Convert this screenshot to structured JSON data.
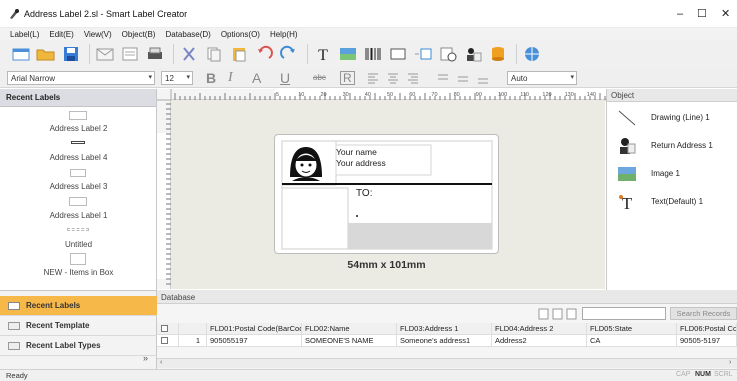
{
  "window": {
    "title": "Address Label 2.sl - Smart Label Creator",
    "minimize": "–",
    "maximize": "☐",
    "close": "✕"
  },
  "menu": [
    "Label(L)",
    "Edit(E)",
    "View(V)",
    "Object(B)",
    "Database(D)",
    "Options(O)",
    "Help(H)"
  ],
  "format": {
    "font": "Arial Narrow",
    "size": "12",
    "bold": "B",
    "italic": "I",
    "color": "A",
    "underline": "U",
    "strike": "abc",
    "autofit": "R",
    "linespacing": "Auto"
  },
  "left": {
    "header": "Recent Labels",
    "labels": [
      "Address Label 2",
      "Address Label 4",
      "Address Label 3",
      "Address Label 1",
      "Untitled",
      "NEW - Items in Box"
    ],
    "tabs": [
      "Recent Labels",
      "Recent Template",
      "Recent Label Types"
    ],
    "expand": "»"
  },
  "ruler": {
    "marks": [
      "5",
      "10",
      "20",
      "30",
      "40",
      "50",
      "60",
      "70",
      "80",
      "90",
      "100",
      "110",
      "120",
      "130",
      "140"
    ]
  },
  "label": {
    "line1": "Your name",
    "line2": "Your address",
    "to": "TO:",
    "size": "54mm x 101mm"
  },
  "object": {
    "header": "Object",
    "items": [
      "Drawing (Line) 1",
      "Return Address 1",
      "Image 1",
      "Text(Default) 1"
    ]
  },
  "database": {
    "header": "Database",
    "search_button": "Search Records",
    "columns": [
      "FLD01:Postal Code(BarCod...",
      "FLD02:Name",
      "FLD03:Address 1",
      "FLD04:Address 2",
      "FLD05:State",
      "FLD06:Postal Cod"
    ],
    "rows": [
      {
        "num": "1",
        "cells": [
          "905055197",
          "SOMEONE'S NAME",
          "Someone's address1",
          "Address2",
          "CA",
          "90505-5197"
        ]
      }
    ]
  },
  "status": {
    "text": "Ready",
    "caps": "CAP",
    "num": "NUM",
    "scrl": "SCRL"
  },
  "colors": {
    "active_tab": "#f7b84a",
    "header_bg": "#dcdde3",
    "canvas_bg": "#ebebe4"
  }
}
